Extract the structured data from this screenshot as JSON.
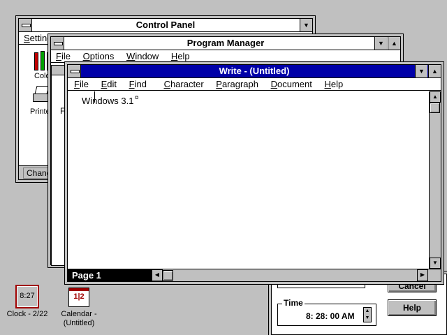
{
  "control_panel": {
    "title": "Control Panel",
    "menu_settings": "Settings",
    "icon_color_label": "Color",
    "icon_printers_label": "Printers",
    "status_text": "Change"
  },
  "program_manager": {
    "title": "Program Manager",
    "menu": [
      "File",
      "Options",
      "Window",
      "Help"
    ],
    "child_letter": "F"
  },
  "write": {
    "title": "Write - (Untitled)",
    "menu": [
      "File",
      "Edit",
      "Find",
      "Character",
      "Paragraph",
      "Document",
      "Help"
    ],
    "document_text": "Windows 3.1",
    "end_mark": "¤",
    "page_label": "Page 1"
  },
  "dialog": {
    "cancel_label": "Cancel",
    "help_label": "Help",
    "time_group_label": "Time",
    "time_value": "8: 28: 00 AM"
  },
  "desktop_icons": {
    "clock_face": "8:27",
    "clock_label": "Clock - 2/22",
    "calendar_label_1": "Calendar -",
    "calendar_label_2": "(Untitled)",
    "calendar_glyph": "1|2"
  },
  "colors": {
    "desktop": "#c0c0c0",
    "active_title": "#0000a8",
    "clock_border": "#a00000"
  }
}
